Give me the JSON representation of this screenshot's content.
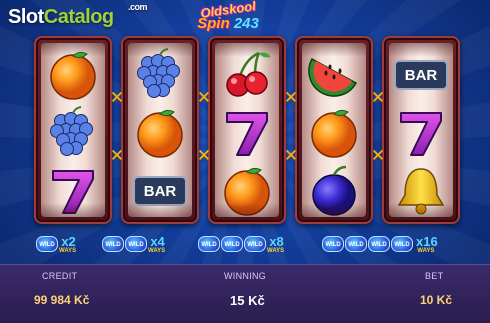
{
  "watermark": {
    "slot": "Slot",
    "catalog": "Catalog",
    "com": ".com"
  },
  "game_logo": {
    "line1": "Oldskool",
    "line2_word": "Spin",
    "line2_num": "243"
  },
  "reels": [
    [
      "orange",
      "grapes",
      "seven"
    ],
    [
      "grapes",
      "orange",
      "bar"
    ],
    [
      "cherries",
      "seven",
      "orange"
    ],
    [
      "watermelon",
      "orange",
      "plum"
    ],
    [
      "bar",
      "seven",
      "bell"
    ]
  ],
  "bar_label": "BAR",
  "multiplier_icon": "cross-x-icon",
  "ways_indicators": [
    {
      "wilds": 1,
      "multiplier": "x2"
    },
    {
      "wilds": 2,
      "multiplier": "x4"
    },
    {
      "wilds": 3,
      "multiplier": "x8"
    },
    {
      "wilds": 4,
      "multiplier": "x16"
    }
  ],
  "wild_label": "WILD",
  "ways_label": "WAYS",
  "panel": {
    "credit_label": "CREDIT",
    "credit_value": "99 984 Kč",
    "winning_label": "WINNING",
    "winning_value": "15 Kč",
    "bet_label": "BET",
    "bet_value": "10 Kč"
  },
  "colors": {
    "background": "#1d55c8",
    "reel_frame": "#6a1f26",
    "multiplier": "#f3b61f",
    "ways_text": "#5ad7ff",
    "panel": "#2a1d4e"
  }
}
